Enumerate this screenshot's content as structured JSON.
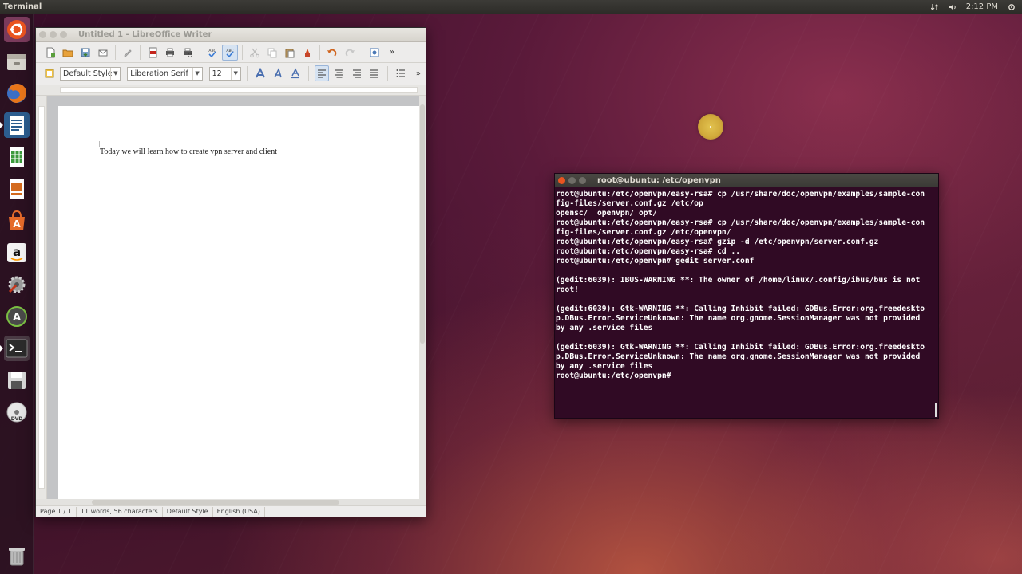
{
  "top_panel": {
    "app_name": "Terminal",
    "clock": "2:12 PM"
  },
  "launcher": {
    "items": [
      {
        "name": "Dash home",
        "icon": "ubuntu-logo-icon"
      },
      {
        "name": "Files",
        "icon": "file-cabinet-icon"
      },
      {
        "name": "Firefox",
        "icon": "firefox-icon"
      },
      {
        "name": "LibreOffice Writer",
        "icon": "writer-icon"
      },
      {
        "name": "LibreOffice Calc",
        "icon": "calc-icon"
      },
      {
        "name": "LibreOffice Impress",
        "icon": "impress-icon"
      },
      {
        "name": "Ubuntu Software Center",
        "icon": "software-center-icon"
      },
      {
        "name": "Amazon",
        "icon": "amazon-icon"
      },
      {
        "name": "System Settings",
        "icon": "settings-icon"
      },
      {
        "name": "Software Updater",
        "icon": "updater-icon"
      },
      {
        "name": "Terminal",
        "icon": "terminal-icon"
      },
      {
        "name": "Save",
        "icon": "floppy-icon"
      },
      {
        "name": "DVD",
        "icon": "dvd-icon"
      },
      {
        "name": "Trash",
        "icon": "trash-icon"
      }
    ]
  },
  "writer": {
    "title": "Untitled 1 - LibreOffice Writer",
    "paragraph_style": "Default Style",
    "font_name": "Liberation Serif",
    "font_size": "12",
    "document_text": "Today we will learn how to create vpn server and client",
    "status": {
      "page": "Page 1 / 1",
      "words": "11 words, 56 characters",
      "style": "Default Style",
      "language": "English (USA)"
    }
  },
  "terminal": {
    "title": "root@ubuntu: /etc/openvpn",
    "lines": [
      "root@ubuntu:/etc/openvpn/easy-rsa# cp /usr/share/doc/openvpn/examples/sample-con",
      "fig-files/server.conf.gz /etc/op",
      "opensc/  openvpn/ opt/",
      "root@ubuntu:/etc/openvpn/easy-rsa# cp /usr/share/doc/openvpn/examples/sample-con",
      "fig-files/server.conf.gz /etc/openvpn/",
      "root@ubuntu:/etc/openvpn/easy-rsa# gzip -d /etc/openvpn/server.conf.gz",
      "root@ubuntu:/etc/openvpn/easy-rsa# cd ..",
      "root@ubuntu:/etc/openvpn# gedit server.conf",
      "",
      "(gedit:6039): IBUS-WARNING **: The owner of /home/linux/.config/ibus/bus is not",
      "root!",
      "",
      "(gedit:6039): Gtk-WARNING **: Calling Inhibit failed: GDBus.Error:org.freedeskto",
      "p.DBus.Error.ServiceUnknown: The name org.gnome.SessionManager was not provided",
      "by any .service files",
      "",
      "(gedit:6039): Gtk-WARNING **: Calling Inhibit failed: GDBus.Error:org.freedeskto",
      "p.DBus.Error.ServiceUnknown: The name org.gnome.SessionManager was not provided",
      "by any .service files",
      "root@ubuntu:/etc/openvpn# "
    ]
  }
}
